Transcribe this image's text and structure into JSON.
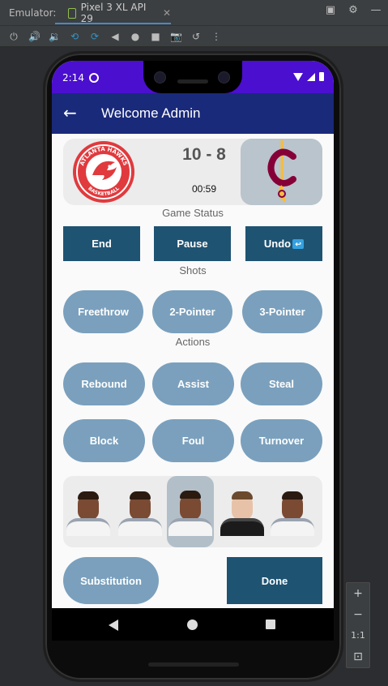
{
  "emulator": {
    "label": "Emulator:",
    "tab_title": "Pixel 3 XL API 29",
    "tab_close": "✕",
    "zoom_label": "1:1"
  },
  "status_bar": {
    "time": "2:14"
  },
  "app_bar": {
    "title": "Welcome Admin"
  },
  "scoreboard": {
    "score": "10 - 8",
    "clock": "00:59",
    "home_team_logo": "atlanta-hawks-logo",
    "away_team_logo": "cleveland-cavaliers-logo",
    "home_logo_text_top": "ATLANTA HAWKS",
    "home_logo_text_bottom": "BASKETBALL"
  },
  "game_status": {
    "label": "Game Status",
    "buttons": [
      "End",
      "Pause",
      "Undo"
    ]
  },
  "shots": {
    "label": "Shots",
    "buttons": [
      "Freethrow",
      "2-Pointer",
      "3-Pointer"
    ]
  },
  "actions": {
    "label": "Actions",
    "row1": [
      "Rebound",
      "Assist",
      "Steal"
    ],
    "row2": [
      "Block",
      "Foul",
      "Turnover"
    ]
  },
  "roster": {
    "selected_index": 2,
    "count": 5
  },
  "footer": {
    "substitution": "Substitution",
    "done": "Done"
  },
  "colors": {
    "status_bar": "#4b0fd0",
    "app_bar": "#1a2a7a",
    "square_button": "#1e5372",
    "pill_button": "#7aa0bd"
  }
}
